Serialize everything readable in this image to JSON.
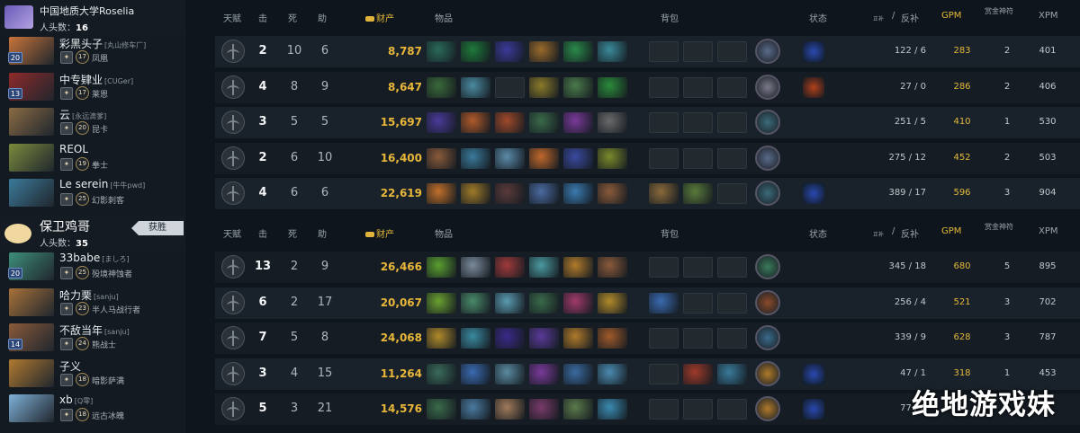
{
  "radiant": {
    "team_name": "中国地质大学Roselia",
    "kills_label": "人头数：",
    "kills": "16"
  },
  "dire": {
    "team_name": "保卫鸡哥",
    "kills_label": "人头数：",
    "kills": "35",
    "win_badge": "获胜"
  },
  "header": {
    "talent": "天赋",
    "kills": "击",
    "deaths": "死",
    "assists": "助",
    "networth": "财产",
    "items": "物品",
    "backpack": "背包",
    "status": "状态",
    "lh_small": "正补",
    "lh_slash": "/",
    "denies": "反补",
    "gpm": "GPM",
    "bounty": "赏金神符",
    "xpm": "XPM"
  },
  "players": [
    {
      "name": "彩黑头子",
      "tag": "[丸山修车厂]",
      "rank": "17",
      "role": "凤凰",
      "level": "20",
      "k": "2",
      "d": "10",
      "a": "6",
      "nw": "8,787",
      "lh": "122 / 6",
      "gpm": "283",
      "bounty": "2",
      "xpm": "401",
      "hero_color": "#c9743a"
    },
    {
      "name": "中专肄业",
      "tag": "[CUGer]",
      "rank": "17",
      "role": "莱恩",
      "level": "13",
      "k": "4",
      "d": "8",
      "a": "9",
      "nw": "8,647",
      "lh": "27 / 0",
      "gpm": "286",
      "bounty": "2",
      "xpm": "406",
      "hero_color": "#8f2a2a"
    },
    {
      "name": "云",
      "tag": "[永远滴爹]",
      "rank": "20",
      "role": "昆卡",
      "level": "",
      "k": "3",
      "d": "5",
      "a": "5",
      "nw": "15,697",
      "lh": "251 / 5",
      "gpm": "410",
      "bounty": "1",
      "xpm": "530",
      "hero_color": "#8a6b44"
    },
    {
      "name": "REOL",
      "tag": "",
      "rank": "19",
      "role": "拳士",
      "level": "",
      "k": "2",
      "d": "6",
      "a": "10",
      "nw": "16,400",
      "lh": "275 / 12",
      "gpm": "452",
      "bounty": "2",
      "xpm": "503",
      "hero_color": "#7a8b3c"
    },
    {
      "name": "Le serein",
      "tag": "[牛牛pwd]",
      "rank": "25",
      "role": "幻影刺客",
      "level": "",
      "k": "4",
      "d": "6",
      "a": "6",
      "nw": "22,619",
      "lh": "389 / 17",
      "gpm": "596",
      "bounty": "3",
      "xpm": "904",
      "hero_color": "#3b7a9a"
    },
    {
      "name": "33babe",
      "tag": "[ましろ]",
      "rank": "25",
      "role": "殁境神蚀者",
      "level": "20",
      "k": "13",
      "d": "2",
      "a": "9",
      "nw": "26,466",
      "lh": "345 / 18",
      "gpm": "680",
      "bounty": "5",
      "xpm": "895",
      "hero_color": "#3d8f7a"
    },
    {
      "name": "哈力栗",
      "tag": "[sanju]",
      "rank": "23",
      "role": "半人马战行者",
      "level": "",
      "k": "6",
      "d": "2",
      "a": "17",
      "nw": "20,067",
      "lh": "256 / 4",
      "gpm": "521",
      "bounty": "3",
      "xpm": "702",
      "hero_color": "#a8723a"
    },
    {
      "name": "不敌当年",
      "tag": "[sanju]",
      "rank": "24",
      "role": "熊战士",
      "level": "14",
      "k": "7",
      "d": "5",
      "a": "8",
      "nw": "24,068",
      "lh": "339 / 9",
      "gpm": "628",
      "bounty": "3",
      "xpm": "787",
      "hero_color": "#8a5a3a"
    },
    {
      "name": "子义",
      "tag": "",
      "rank": "18",
      "role": "暗影萨满",
      "level": "",
      "k": "3",
      "d": "4",
      "a": "15",
      "nw": "11,264",
      "lh": "47 / 1",
      "gpm": "318",
      "bounty": "1",
      "xpm": "453",
      "hero_color": "#b07a30"
    },
    {
      "name": "xb",
      "tag": "[Q零]",
      "rank": "18",
      "role": "远古冰魄",
      "level": "",
      "k": "5",
      "d": "3",
      "a": "21",
      "nw": "14,576",
      "lh": "77 / 6",
      "gpm": "",
      "bounty": "",
      "xpm": "",
      "hero_color": "#7fb0d8"
    }
  ],
  "watermark": "绝地游戏妹",
  "colors": {
    "gold": "#e3b93a",
    "panel": "#131a21",
    "row": "#19212a"
  }
}
